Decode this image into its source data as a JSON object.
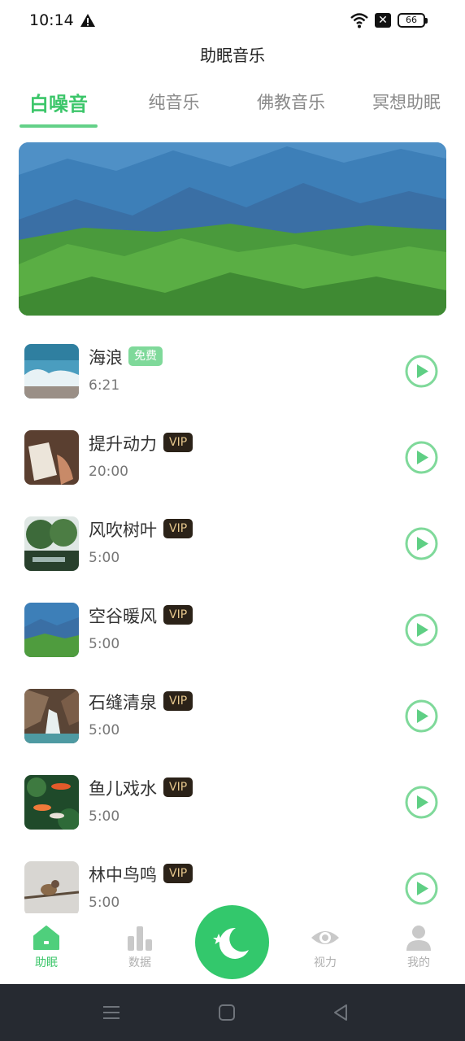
{
  "status_bar": {
    "time": "10:14",
    "battery": "66",
    "sim": "✕"
  },
  "header": {
    "title": "助眠音乐"
  },
  "tabs": [
    {
      "label": "白噪音",
      "active": true
    },
    {
      "label": "纯音乐",
      "active": false
    },
    {
      "label": "佛教音乐",
      "active": false
    },
    {
      "label": "冥想助眠",
      "active": false
    }
  ],
  "tracks": [
    {
      "name": "海浪",
      "badge": "免费",
      "badge_type": "free",
      "duration": "6:21"
    },
    {
      "name": "提升动力",
      "badge": "VIP",
      "badge_type": "vip",
      "duration": "20:00"
    },
    {
      "name": "风吹树叶",
      "badge": "VIP",
      "badge_type": "vip",
      "duration": "5:00"
    },
    {
      "name": "空谷暖风",
      "badge": "VIP",
      "badge_type": "vip",
      "duration": "5:00"
    },
    {
      "name": "石缝清泉",
      "badge": "VIP",
      "badge_type": "vip",
      "duration": "5:00"
    },
    {
      "name": "鱼儿戏水",
      "badge": "VIP",
      "badge_type": "vip",
      "duration": "5:00"
    },
    {
      "name": "林中鸟鸣",
      "badge": "VIP",
      "badge_type": "vip",
      "duration": "5:00"
    }
  ],
  "bottom_nav": [
    {
      "label": "助眠",
      "icon": "home-icon",
      "active": true
    },
    {
      "label": "数据",
      "icon": "bar-chart-icon",
      "active": false
    },
    {
      "label": "",
      "icon": "moon-icon",
      "active": false
    },
    {
      "label": "视力",
      "icon": "eye-icon",
      "active": false
    },
    {
      "label": "我的",
      "icon": "user-icon",
      "active": false
    }
  ],
  "colors": {
    "accent": "#3cc66a",
    "vip_bg": "#2b2218",
    "vip_text": "#e6c78c",
    "free_bg": "#7fd99a"
  }
}
